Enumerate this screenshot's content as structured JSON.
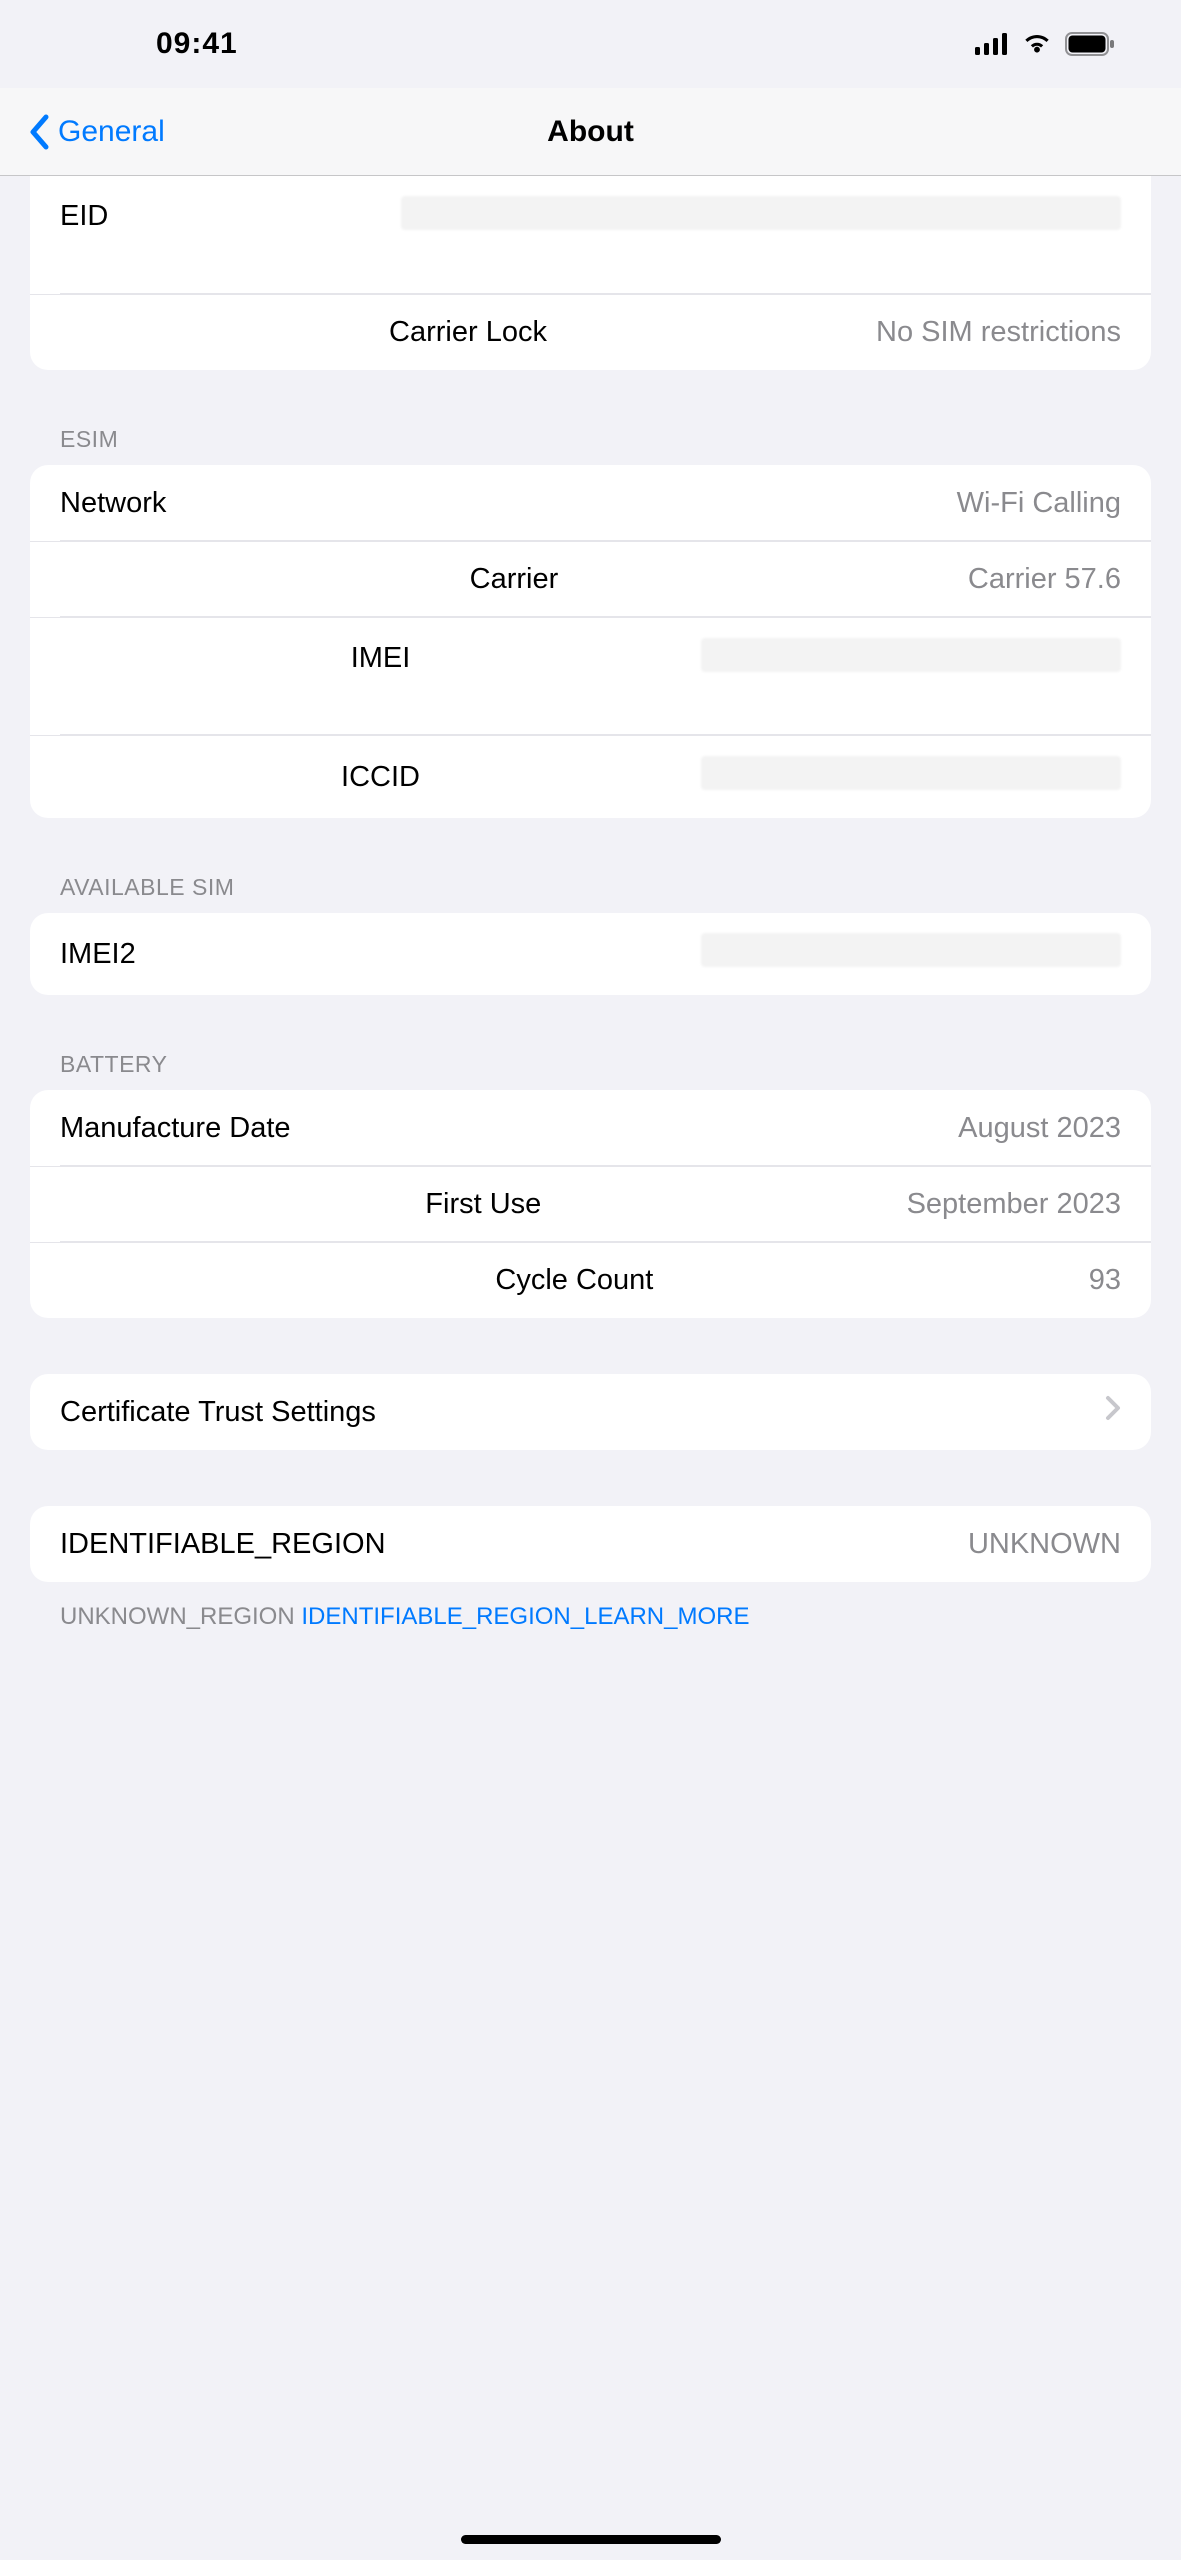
{
  "statusBar": {
    "time": "09:41"
  },
  "nav": {
    "back": "General",
    "title": "About"
  },
  "topGroup": {
    "eid": {
      "label": "EID",
      "value": ""
    },
    "carrierLock": {
      "label": "Carrier Lock",
      "value": "No SIM restrictions"
    }
  },
  "esimHeader": "ESIM",
  "esim": {
    "network": {
      "label": "Network",
      "value": "Wi-Fi Calling"
    },
    "carrier": {
      "label": "Carrier",
      "value": "Carrier 57.6"
    },
    "imei": {
      "label": "IMEI",
      "value": ""
    },
    "iccid": {
      "label": "ICCID",
      "value": ""
    }
  },
  "availHeader": "AVAILABLE SIM",
  "avail": {
    "imei2": {
      "label": "IMEI2",
      "value": ""
    }
  },
  "batteryHeader": "BATTERY",
  "battery": {
    "manufacture": {
      "label": "Manufacture Date",
      "value": "August 2023"
    },
    "firstUse": {
      "label": "First Use",
      "value": "September 2023"
    },
    "cycle": {
      "label": "Cycle Count",
      "value": "93"
    }
  },
  "cert": {
    "label": "Certificate Trust Settings"
  },
  "region": {
    "label": "IDENTIFIABLE_REGION",
    "value": "UNKNOWN"
  },
  "footer": {
    "text": "UNKNOWN_REGION ",
    "link": "IDENTIFIABLE_REGION_LEARN_MORE"
  }
}
